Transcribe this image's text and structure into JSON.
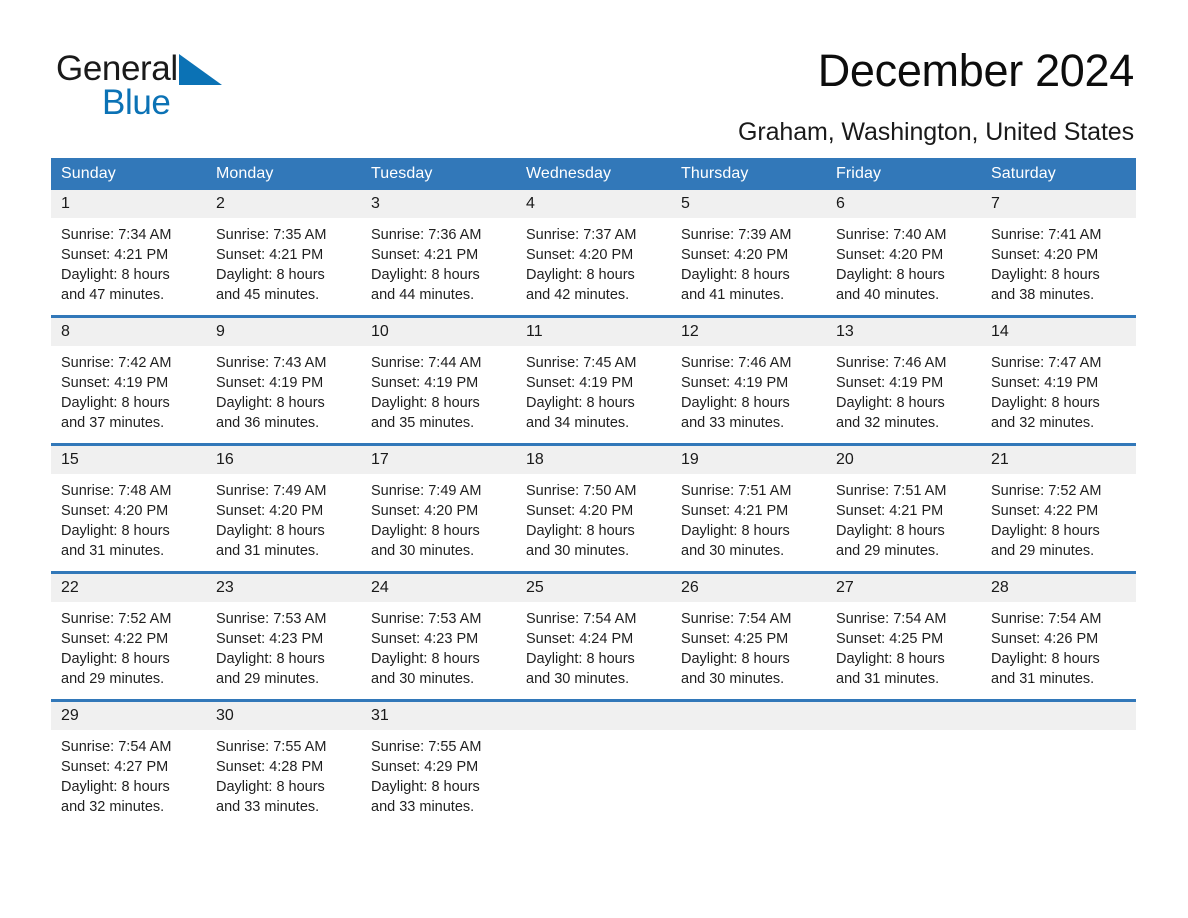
{
  "brand": {
    "name_part1": "General",
    "name_part2": "Blue",
    "triangle_icon": "brand-triangle-icon",
    "accent_color": "#0b72b5"
  },
  "header": {
    "month_title": "December 2024",
    "location": "Graham, Washington, United States"
  },
  "theme": {
    "header_blue": "#3278b9",
    "daynum_band": "#f0f0f0",
    "text": "#1f1f1f"
  },
  "weekday_headers": [
    "Sunday",
    "Monday",
    "Tuesday",
    "Wednesday",
    "Thursday",
    "Friday",
    "Saturday"
  ],
  "labels": {
    "sunrise_prefix": "Sunrise:",
    "sunset_prefix": "Sunset:",
    "daylight_prefix": "Daylight:"
  },
  "weeks": [
    [
      {
        "day": "1",
        "sunrise": "Sunrise: 7:34 AM",
        "sunset": "Sunset: 4:21 PM",
        "daylight_line1": "Daylight: 8 hours",
        "daylight_line2": "and 47 minutes."
      },
      {
        "day": "2",
        "sunrise": "Sunrise: 7:35 AM",
        "sunset": "Sunset: 4:21 PM",
        "daylight_line1": "Daylight: 8 hours",
        "daylight_line2": "and 45 minutes."
      },
      {
        "day": "3",
        "sunrise": "Sunrise: 7:36 AM",
        "sunset": "Sunset: 4:21 PM",
        "daylight_line1": "Daylight: 8 hours",
        "daylight_line2": "and 44 minutes."
      },
      {
        "day": "4",
        "sunrise": "Sunrise: 7:37 AM",
        "sunset": "Sunset: 4:20 PM",
        "daylight_line1": "Daylight: 8 hours",
        "daylight_line2": "and 42 minutes."
      },
      {
        "day": "5",
        "sunrise": "Sunrise: 7:39 AM",
        "sunset": "Sunset: 4:20 PM",
        "daylight_line1": "Daylight: 8 hours",
        "daylight_line2": "and 41 minutes."
      },
      {
        "day": "6",
        "sunrise": "Sunrise: 7:40 AM",
        "sunset": "Sunset: 4:20 PM",
        "daylight_line1": "Daylight: 8 hours",
        "daylight_line2": "and 40 minutes."
      },
      {
        "day": "7",
        "sunrise": "Sunrise: 7:41 AM",
        "sunset": "Sunset: 4:20 PM",
        "daylight_line1": "Daylight: 8 hours",
        "daylight_line2": "and 38 minutes."
      }
    ],
    [
      {
        "day": "8",
        "sunrise": "Sunrise: 7:42 AM",
        "sunset": "Sunset: 4:19 PM",
        "daylight_line1": "Daylight: 8 hours",
        "daylight_line2": "and 37 minutes."
      },
      {
        "day": "9",
        "sunrise": "Sunrise: 7:43 AM",
        "sunset": "Sunset: 4:19 PM",
        "daylight_line1": "Daylight: 8 hours",
        "daylight_line2": "and 36 minutes."
      },
      {
        "day": "10",
        "sunrise": "Sunrise: 7:44 AM",
        "sunset": "Sunset: 4:19 PM",
        "daylight_line1": "Daylight: 8 hours",
        "daylight_line2": "and 35 minutes."
      },
      {
        "day": "11",
        "sunrise": "Sunrise: 7:45 AM",
        "sunset": "Sunset: 4:19 PM",
        "daylight_line1": "Daylight: 8 hours",
        "daylight_line2": "and 34 minutes."
      },
      {
        "day": "12",
        "sunrise": "Sunrise: 7:46 AM",
        "sunset": "Sunset: 4:19 PM",
        "daylight_line1": "Daylight: 8 hours",
        "daylight_line2": "and 33 minutes."
      },
      {
        "day": "13",
        "sunrise": "Sunrise: 7:46 AM",
        "sunset": "Sunset: 4:19 PM",
        "daylight_line1": "Daylight: 8 hours",
        "daylight_line2": "and 32 minutes."
      },
      {
        "day": "14",
        "sunrise": "Sunrise: 7:47 AM",
        "sunset": "Sunset: 4:19 PM",
        "daylight_line1": "Daylight: 8 hours",
        "daylight_line2": "and 32 minutes."
      }
    ],
    [
      {
        "day": "15",
        "sunrise": "Sunrise: 7:48 AM",
        "sunset": "Sunset: 4:20 PM",
        "daylight_line1": "Daylight: 8 hours",
        "daylight_line2": "and 31 minutes."
      },
      {
        "day": "16",
        "sunrise": "Sunrise: 7:49 AM",
        "sunset": "Sunset: 4:20 PM",
        "daylight_line1": "Daylight: 8 hours",
        "daylight_line2": "and 31 minutes."
      },
      {
        "day": "17",
        "sunrise": "Sunrise: 7:49 AM",
        "sunset": "Sunset: 4:20 PM",
        "daylight_line1": "Daylight: 8 hours",
        "daylight_line2": "and 30 minutes."
      },
      {
        "day": "18",
        "sunrise": "Sunrise: 7:50 AM",
        "sunset": "Sunset: 4:20 PM",
        "daylight_line1": "Daylight: 8 hours",
        "daylight_line2": "and 30 minutes."
      },
      {
        "day": "19",
        "sunrise": "Sunrise: 7:51 AM",
        "sunset": "Sunset: 4:21 PM",
        "daylight_line1": "Daylight: 8 hours",
        "daylight_line2": "and 30 minutes."
      },
      {
        "day": "20",
        "sunrise": "Sunrise: 7:51 AM",
        "sunset": "Sunset: 4:21 PM",
        "daylight_line1": "Daylight: 8 hours",
        "daylight_line2": "and 29 minutes."
      },
      {
        "day": "21",
        "sunrise": "Sunrise: 7:52 AM",
        "sunset": "Sunset: 4:22 PM",
        "daylight_line1": "Daylight: 8 hours",
        "daylight_line2": "and 29 minutes."
      }
    ],
    [
      {
        "day": "22",
        "sunrise": "Sunrise: 7:52 AM",
        "sunset": "Sunset: 4:22 PM",
        "daylight_line1": "Daylight: 8 hours",
        "daylight_line2": "and 29 minutes."
      },
      {
        "day": "23",
        "sunrise": "Sunrise: 7:53 AM",
        "sunset": "Sunset: 4:23 PM",
        "daylight_line1": "Daylight: 8 hours",
        "daylight_line2": "and 29 minutes."
      },
      {
        "day": "24",
        "sunrise": "Sunrise: 7:53 AM",
        "sunset": "Sunset: 4:23 PM",
        "daylight_line1": "Daylight: 8 hours",
        "daylight_line2": "and 30 minutes."
      },
      {
        "day": "25",
        "sunrise": "Sunrise: 7:54 AM",
        "sunset": "Sunset: 4:24 PM",
        "daylight_line1": "Daylight: 8 hours",
        "daylight_line2": "and 30 minutes."
      },
      {
        "day": "26",
        "sunrise": "Sunrise: 7:54 AM",
        "sunset": "Sunset: 4:25 PM",
        "daylight_line1": "Daylight: 8 hours",
        "daylight_line2": "and 30 minutes."
      },
      {
        "day": "27",
        "sunrise": "Sunrise: 7:54 AM",
        "sunset": "Sunset: 4:25 PM",
        "daylight_line1": "Daylight: 8 hours",
        "daylight_line2": "and 31 minutes."
      },
      {
        "day": "28",
        "sunrise": "Sunrise: 7:54 AM",
        "sunset": "Sunset: 4:26 PM",
        "daylight_line1": "Daylight: 8 hours",
        "daylight_line2": "and 31 minutes."
      }
    ],
    [
      {
        "day": "29",
        "sunrise": "Sunrise: 7:54 AM",
        "sunset": "Sunset: 4:27 PM",
        "daylight_line1": "Daylight: 8 hours",
        "daylight_line2": "and 32 minutes."
      },
      {
        "day": "30",
        "sunrise": "Sunrise: 7:55 AM",
        "sunset": "Sunset: 4:28 PM",
        "daylight_line1": "Daylight: 8 hours",
        "daylight_line2": "and 33 minutes."
      },
      {
        "day": "31",
        "sunrise": "Sunrise: 7:55 AM",
        "sunset": "Sunset: 4:29 PM",
        "daylight_line1": "Daylight: 8 hours",
        "daylight_line2": "and 33 minutes."
      },
      {
        "day": "",
        "sunrise": "",
        "sunset": "",
        "daylight_line1": "",
        "daylight_line2": ""
      },
      {
        "day": "",
        "sunrise": "",
        "sunset": "",
        "daylight_line1": "",
        "daylight_line2": ""
      },
      {
        "day": "",
        "sunrise": "",
        "sunset": "",
        "daylight_line1": "",
        "daylight_line2": ""
      },
      {
        "day": "",
        "sunrise": "",
        "sunset": "",
        "daylight_line1": "",
        "daylight_line2": ""
      }
    ]
  ]
}
